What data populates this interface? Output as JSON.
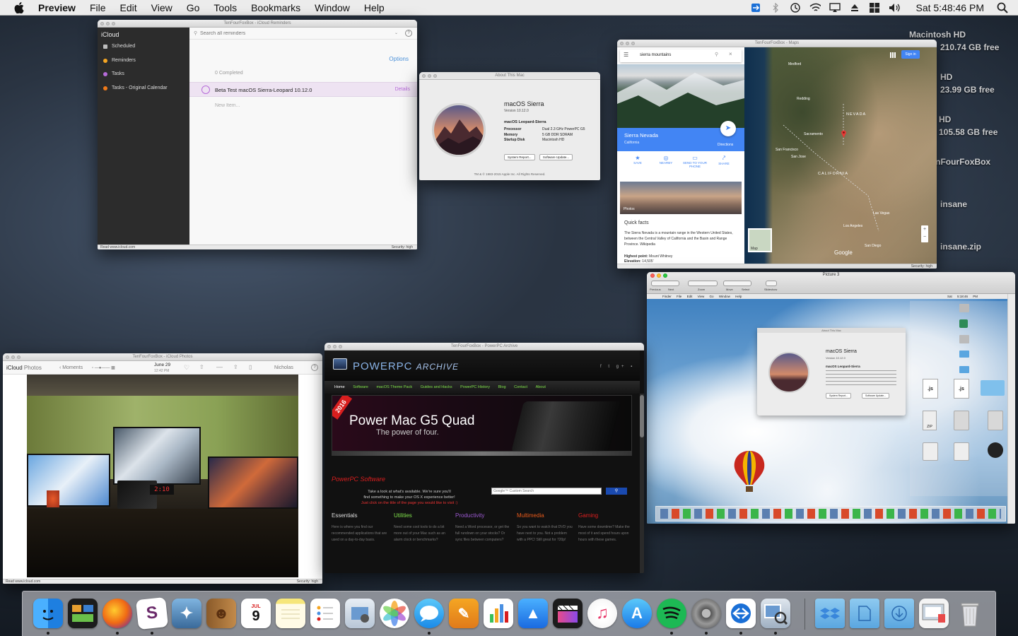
{
  "menubar": {
    "app": "Preview",
    "items": [
      "File",
      "Edit",
      "View",
      "Go",
      "Tools",
      "Bookmarks",
      "Window",
      "Help"
    ],
    "clock": "Sat 5:48:46 PM"
  },
  "desktop": {
    "labels": [
      "Macintosh HD",
      "210.74 GB free",
      "HD",
      "23.99 GB free",
      "HD",
      "105.58 GB free",
      "TenFourFoxBox",
      "insane",
      "insane.zip"
    ]
  },
  "reminders": {
    "title": "TenFourFoxBox - iCloud Reminders",
    "account": "iCloud",
    "search_placeholder": "Search all reminders",
    "sidebar": [
      {
        "label": "Scheduled",
        "color": "#bdbdbd"
      },
      {
        "label": "Reminders",
        "color": "#f5a623"
      },
      {
        "label": "Tasks",
        "color": "#b66bd8"
      },
      {
        "label": "Tasks - Original Calendar",
        "color": "#f07a1a"
      }
    ],
    "options": "Options",
    "completed": "0 Completed",
    "item": "Beta Test macOS Sierra-Leopard 10.12.0",
    "details": "Details",
    "new_item": "New Item...",
    "status_left": "Read www.icloud.com",
    "status_right": "Security: high"
  },
  "about": {
    "title": "About This Mac",
    "os": "macOS Sierra",
    "version": "Version 10.12.0",
    "machine": "macOS Leopard-Sierra",
    "specs": [
      [
        "Processor",
        "Dual 2.3 GHz PowerPC G5"
      ],
      [
        "Memory",
        "5 GB DDR SDRAM"
      ],
      [
        "Startup Disk",
        "Macintosh HD"
      ]
    ],
    "btn_report": "System Report...",
    "btn_update": "Software Update...",
    "footer": "TM & © 1983-2015 Apple Inc. All Rights Reserved."
  },
  "maps": {
    "title": "TenFourFoxBox - Maps",
    "search": "sierra mountains",
    "signin": "Sign in",
    "place": "Sierra Nevada",
    "region": "California",
    "directions": "Directions",
    "actions": [
      "SAVE",
      "NEARBY",
      "SEND TO YOUR PHONE",
      "SHARE"
    ],
    "photos": "Photos",
    "quick_facts": "Quick facts",
    "facts_text": "The Sierra Nevada is a mountain range in the Western United States, between the Central Valley of California and the Basin and Range Province. Wikipedia",
    "highest_label": "Highest point:",
    "highest": "Mount Whitney",
    "elevation_label": "Elevation:",
    "elevation": "14,505'",
    "map_labels": [
      "Medford",
      "Redding",
      "NEVADA",
      "Sacramento",
      "San Francisco",
      "San Jose",
      "CALIFORNIA",
      "Las Vegas",
      "Los Angeles",
      "San Diego"
    ],
    "google": "Google",
    "map_btn": "Map",
    "status_right": "Security: high"
  },
  "preview": {
    "title": "Picture 3",
    "tools": [
      "Previous",
      "Next",
      "Zoom",
      "Move",
      "Select",
      "Slideshow"
    ],
    "inner_menu": [
      "Finder",
      "File",
      "Edit",
      "View",
      "Go",
      "Window",
      "Help"
    ],
    "inner_clock": "Sat 5:18:46 PM",
    "inner_about": {
      "title": "About This Mac",
      "os": "macOS Sierra",
      "version": "Version 10.12.0",
      "machine": "macOS Leopard-Sierra",
      "btn_report": "System Report...",
      "btn_update": "Software Update..."
    }
  },
  "photos": {
    "title": "TenFourFoxBox - iCloud Photos",
    "app": "iCloud",
    "app2": "Photos",
    "moments": "Moments",
    "date": "June 29",
    "time": "12:42 PM",
    "user": "Nicholas",
    "clock_display": "2:10",
    "status_left": "Read www.icloud.com",
    "status_right": "Security: high"
  },
  "ppc": {
    "title": "TenFourFoxBox - PowerPC Archive",
    "logo_a": "POWERPC",
    "logo_b": "ARCHIVE",
    "nav": [
      "Home",
      "Software",
      "macOS Theme Pack",
      "Guides and Hacks",
      "PowerPC History",
      "Blog",
      "Contact",
      "About"
    ],
    "banner_year": "2016",
    "banner_title": "Power Mac G5 Quad",
    "banner_sub": "The power of four.",
    "section": "PowerPC Software",
    "intro1": "Take a look at what's available. We're sure you'll",
    "intro2": "find something to make your OS X experience better!",
    "intro3": "Just click on the title of the page you would like to visit :)",
    "search_placeholder": "Google™ Custom Search",
    "cats": [
      {
        "name": "Essentials",
        "color": "#dddddd",
        "text": "Here is where you find our recommended applications that are used on a day-to-day basis."
      },
      {
        "name": "Utilities",
        "color": "#7fe04a",
        "text": "Need some cool tools to do a bit more out of your Mac such as an alarm clock or benchmarks?"
      },
      {
        "name": "Productivity",
        "color": "#9b59d0",
        "text": "Need a Word processor, or get the full rundown on your stocks? Or sync files between computers?"
      },
      {
        "name": "Multimedia",
        "color": "#e85a1a",
        "text": "So you want to watch that DVD you have next to you. Not a problem with a PPC! Still great for 720p!"
      },
      {
        "name": "Gaming",
        "color": "#e01f1f",
        "text": "Have some downtime? Make the most of it and spend hours upon hours with these games."
      }
    ]
  },
  "dock": {
    "items": [
      "finder",
      "mission-control",
      "firefox",
      "slack",
      "preview-bird",
      "contacts",
      "calendar",
      "notes",
      "reminders",
      "image-capture",
      "photos",
      "messages",
      "pages",
      "numbers",
      "keynote",
      "final-cut",
      "itunes",
      "app-store",
      "spotify",
      "system-preferences",
      "teamviewer",
      "preview",
      "dropbox-folder",
      "documents-folder",
      "downloads-folder",
      "screenshot",
      "trash"
    ],
    "calendar_month": "JUL",
    "calendar_day": "9"
  }
}
